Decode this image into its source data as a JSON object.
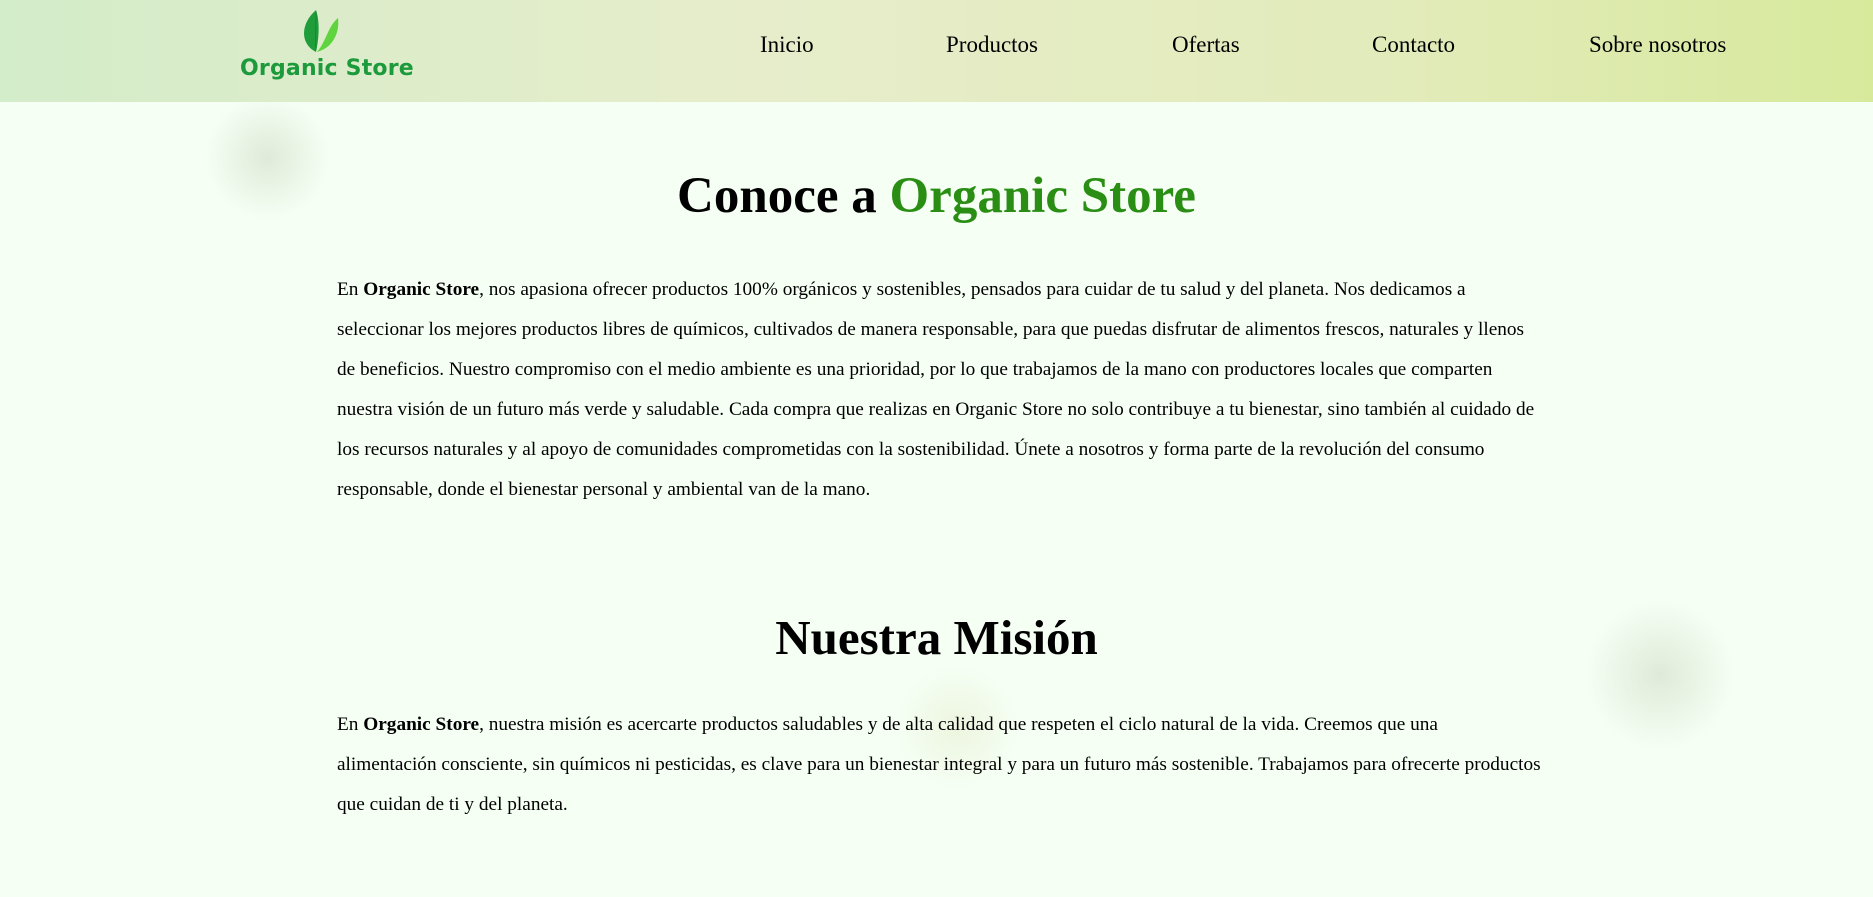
{
  "header": {
    "logo_text": "Organic Store",
    "nav": [
      "Inicio",
      "Productos",
      "Ofertas",
      "Contacto",
      "Sobre nosotros"
    ]
  },
  "about": {
    "title_prefix": "Conoce a ",
    "title_highlight": "Organic Store",
    "para_start": "En ",
    "para_brand": "Organic Store",
    "para_rest": ", nos apasiona ofrecer productos 100% orgánicos y sostenibles, pensados para cuidar de tu salud y del planeta. Nos dedicamos a seleccionar los mejores productos libres de químicos, cultivados de manera responsable, para que puedas disfrutar de alimentos frescos, naturales y llenos de beneficios. Nuestro compromiso con el medio ambiente es una prioridad, por lo que trabajamos de la mano con productores locales que comparten nuestra visión de un futuro más verde y saludable. Cada compra que realizas en Organic Store no solo contribuye a tu bienestar, sino también al cuidado de los recursos naturales y al apoyo de comunidades comprometidas con la sostenibilidad. Únete a nosotros y forma parte de la revolución del consumo responsable, donde el bienestar personal y ambiental van de la mano."
  },
  "mission": {
    "title": "Nuestra Misión",
    "para_start": "En ",
    "para_brand": "Organic Store",
    "para_rest": ", nuestra misión es acercarte productos saludables y de alta calidad que respeten el ciclo natural de la vida. Creemos que una alimentación consciente, sin químicos ni pesticidas, es clave para un bienestar integral y para un futuro más sostenible. Trabajamos para ofrecerte productos que cuidan de ti y del planeta."
  },
  "colors": {
    "accent": "#2a8e14",
    "logo": "#1c9a3c",
    "background": "#f5fff4"
  },
  "icons": {
    "logo": "leaf-icon"
  }
}
